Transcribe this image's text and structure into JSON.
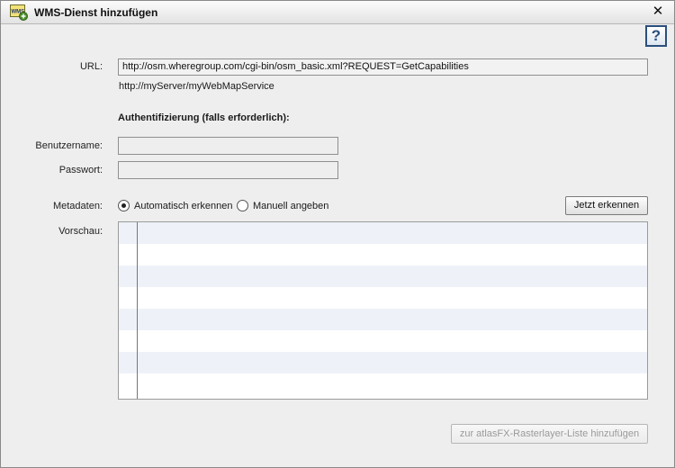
{
  "window": {
    "title": "WMS-Dienst hinzufügen",
    "close_glyph": "✕",
    "help_glyph": "?",
    "icon_text": "WMS"
  },
  "form": {
    "url_label": "URL:",
    "url_value": "http://osm.wheregroup.com/cgi-bin/osm_basic.xml?REQUEST=GetCapabilities",
    "url_hint": "http://myServer/myWebMapService",
    "auth_title": "Authentifizierung (falls erforderlich):",
    "username_label": "Benutzername:",
    "username_value": "",
    "password_label": "Passwort:",
    "password_value": "",
    "metadata_label": "Metadaten:",
    "metadata_options": [
      {
        "label": "Automatisch erkennen",
        "checked": true
      },
      {
        "label": "Manuell angeben",
        "checked": false
      }
    ],
    "detect_button": "Jetzt erkennen",
    "preview_label": "Vorschau:"
  },
  "footer": {
    "add_button": "zur atlasFX-Rasterlayer-Liste hinzufügen",
    "add_button_enabled": false
  },
  "colors": {
    "help_accent": "#2a4f7c",
    "icon_green": "#4c8f2c",
    "preview_alt_row": "#eef2f8"
  }
}
